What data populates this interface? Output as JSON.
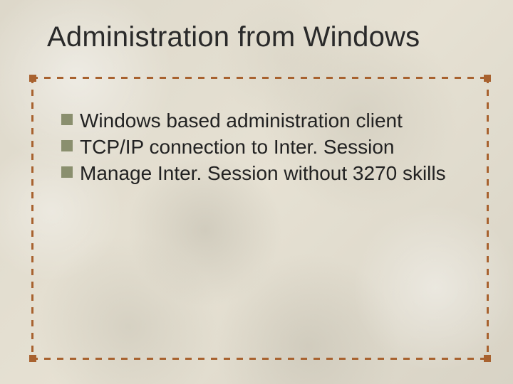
{
  "slide": {
    "title": "Administration from Windows",
    "bullets": [
      "Windows based administration client",
      "TCP/IP connection to Inter. Session",
      "Manage Inter. Session without 3270 skills"
    ]
  },
  "colors": {
    "bullet_square": "#8a8f6e",
    "frame_dash": "#a8622f",
    "text": "#222222"
  }
}
